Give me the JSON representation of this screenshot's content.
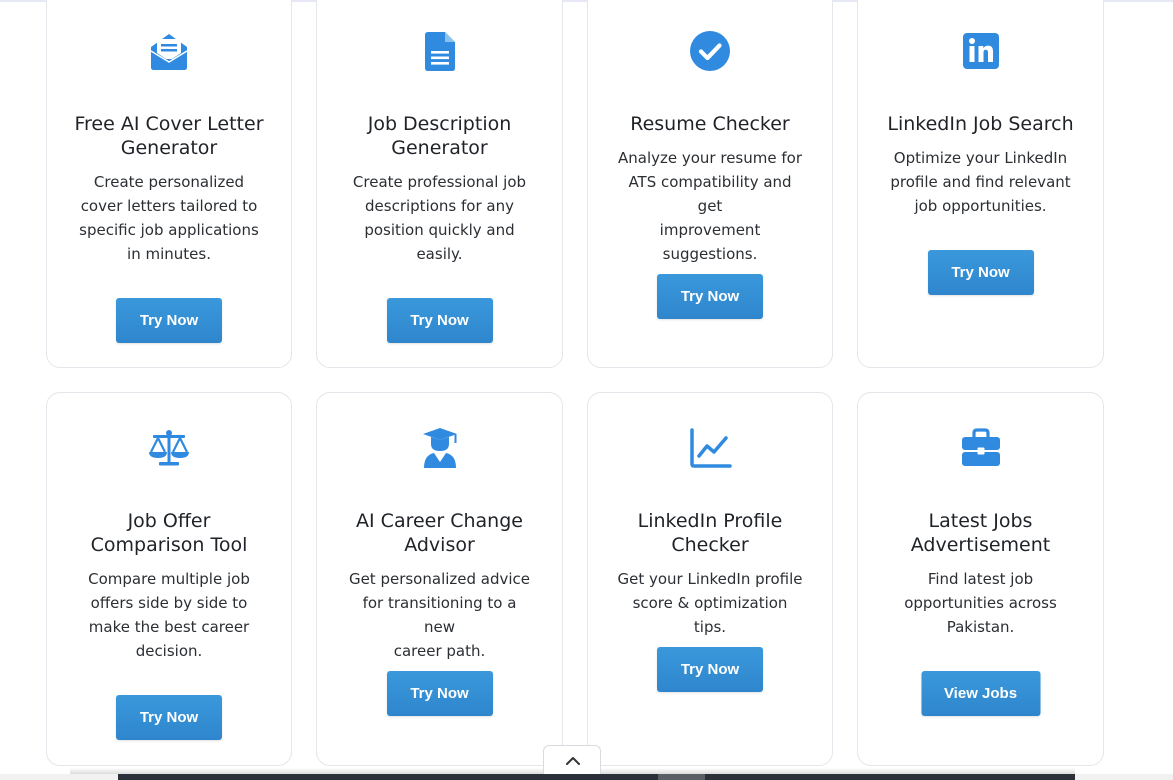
{
  "accent_color": "#2f8ae0",
  "button_color": "#3191d6",
  "cards": [
    {
      "icon": "envelope-open-icon",
      "title_lines": [
        "Free AI Cover Letter",
        "Generator"
      ],
      "desc_lines": [
        "Create personalized",
        "cover letters tailored to",
        "specific job applications",
        "in minutes."
      ],
      "button": "Try Now"
    },
    {
      "icon": "document-icon",
      "title_lines": [
        "Job Description",
        "Generator"
      ],
      "desc_lines": [
        "Create professional job",
        "descriptions for any",
        "position quickly and",
        "easily."
      ],
      "button": "Try Now"
    },
    {
      "icon": "check-circle-icon",
      "title_lines": [
        "Resume Checker"
      ],
      "desc_lines": [
        "Analyze your resume for",
        "ATS compatibility and get",
        "improvement",
        "suggestions."
      ],
      "button": "Try Now"
    },
    {
      "icon": "linkedin-icon",
      "title_lines": [
        "LinkedIn Job Search"
      ],
      "desc_lines": [
        "Optimize your LinkedIn",
        "profile and find relevant",
        "job opportunities."
      ],
      "button": "Try Now"
    },
    {
      "icon": "balance-scale-icon",
      "title_lines": [
        "Job Offer",
        "Comparison Tool"
      ],
      "desc_lines": [
        "Compare multiple job",
        "offers side by side to",
        "make the best career",
        "decision."
      ],
      "button": "Try Now"
    },
    {
      "icon": "graduate-user-icon",
      "title_lines": [
        "AI Career Change",
        "Advisor"
      ],
      "desc_lines": [
        "Get personalized advice",
        "for transitioning to a new",
        "career path."
      ],
      "button": "Try Now"
    },
    {
      "icon": "line-chart-icon",
      "title_lines": [
        "LinkedIn Profile",
        "Checker"
      ],
      "desc_lines": [
        "Get your LinkedIn profile",
        "score & optimization tips."
      ],
      "button": "Try Now"
    },
    {
      "icon": "briefcase-icon",
      "title_lines": [
        "Latest Jobs",
        "Advertisement"
      ],
      "desc_lines": [
        "Find latest job",
        "opportunities across",
        "Pakistan."
      ],
      "button": "View Jobs"
    }
  ],
  "scroll_top_icon": "chevron-up-icon"
}
